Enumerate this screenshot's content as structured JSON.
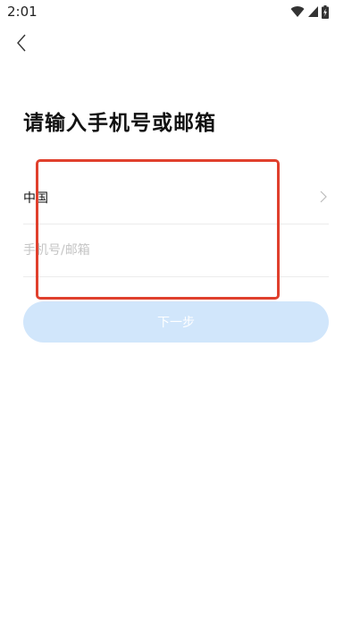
{
  "status_bar": {
    "time": "2:01",
    "icons": [
      "wifi-icon",
      "cell-signal-icon",
      "battery-charging-icon"
    ]
  },
  "header": {
    "back_icon": "chevron-left-icon"
  },
  "title": "请输入手机号或邮箱",
  "form": {
    "country": {
      "label": "中国",
      "icon": "chevron-right-icon"
    },
    "account_input": {
      "value": "",
      "placeholder": "手机号/邮箱"
    },
    "next_button": {
      "label": "下一步",
      "disabled": true
    }
  },
  "colors": {
    "button_disabled_bg": "#d1e6fb",
    "highlight_border": "#e0402d",
    "divider": "#ececec",
    "placeholder": "#c4c4c4"
  }
}
